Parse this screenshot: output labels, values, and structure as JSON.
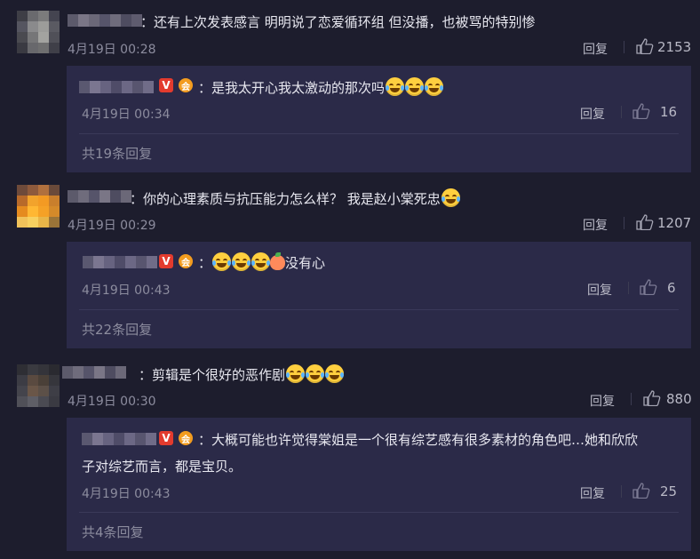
{
  "comments": [
    {
      "text": "：还有上次发表感言 明明说了恋爱循环组 但没播，也被骂的特别惨",
      "time": "4月19日 00:28",
      "reply_label": "回复",
      "likes": "2153",
      "reply": {
        "text": "：是我太开心我太激动的那次吗",
        "emojis": [
          "laugh-cry-emoji",
          "laugh-cry-emoji",
          "laugh-cry-emoji"
        ],
        "time": "4月19日 00:34",
        "reply_label": "回复",
        "likes": "16"
      },
      "more_replies": "共19条回复"
    },
    {
      "text": "：你的心理素质与抗压能力怎么样？ 我是赵小棠死忠",
      "time": "4月19日 00:29",
      "reply_label": "回复",
      "likes": "1207",
      "reply": {
        "text": "没有心",
        "emojis": [
          "laugh-cry-emoji",
          "laugh-cry-emoji",
          "laugh-cry-emoji",
          "peach-emoji"
        ],
        "time": "4月19日 00:43",
        "reply_label": "回复",
        "likes": "6"
      },
      "more_replies": "共22条回复"
    },
    {
      "text": "：剪辑是个很好的恶作剧",
      "time": "4月19日 00:30",
      "reply_label": "回复",
      "likes": "880",
      "reply": {
        "text_line1": "：大概可能也许觉得棠姐是一个很有综艺感有很多素材的角色吧…她和欣欣",
        "text_line2": "子对综艺而言，都是宝贝。",
        "time": "4月19日 00:43",
        "reply_label": "回复",
        "likes": "25"
      },
      "more_replies": "共4条回复"
    }
  ],
  "badges": {
    "verified": "V",
    "vip": "会"
  },
  "colors": {
    "background": "#1d1d2d",
    "reply_bg": "#2b2a48",
    "meta": "#8c8c9e",
    "verified_red": "#e33b2e",
    "vip_orange": "#f39c1f"
  }
}
